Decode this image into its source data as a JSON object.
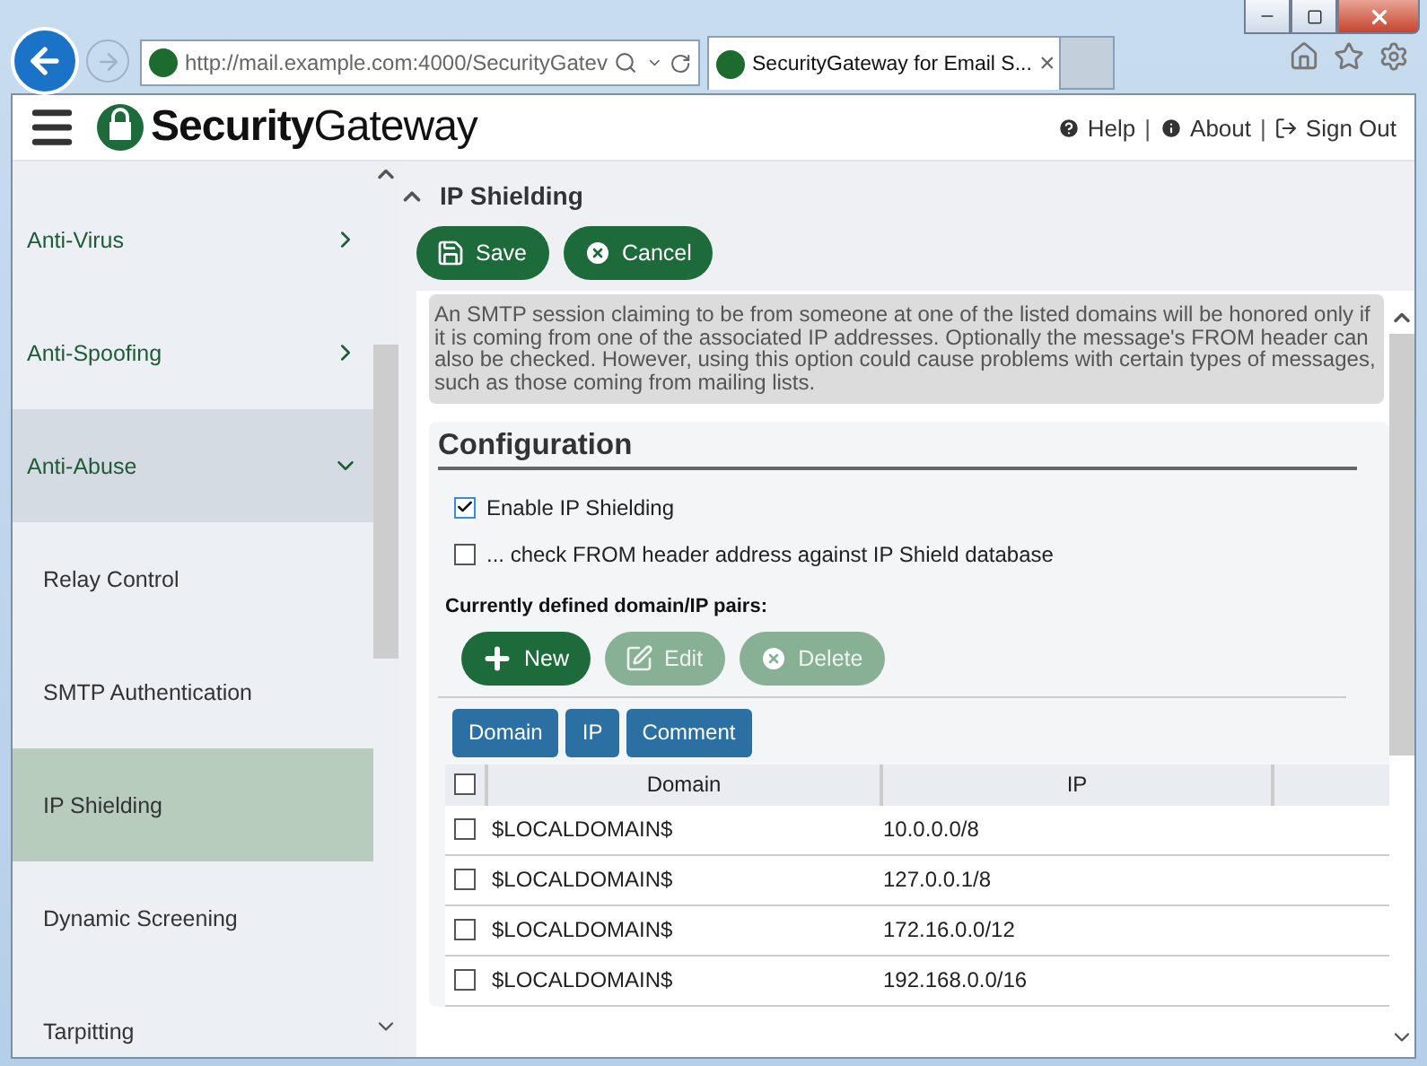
{
  "browser": {
    "address": "http://mail.example.com:4000/SecurityGatev",
    "tab_title": "SecurityGateway for Email S...",
    "tab_close": "×"
  },
  "header": {
    "logo": "**Security**Gateway",
    "links": [
      {
        "kind": "help",
        "label": "Help"
      },
      {
        "kind": "about",
        "label": "About"
      },
      {
        "kind": "signout",
        "label": "Sign Out"
      }
    ],
    "separator": "|"
  },
  "sidebar": {
    "items": [
      {
        "kind": "group",
        "label": "Anti-Virus",
        "expanded": false,
        "selected": false
      },
      {
        "kind": "group",
        "label": "Anti-Spoofing",
        "expanded": false,
        "selected": false
      },
      {
        "kind": "group",
        "label": "Anti-Abuse",
        "expanded": true,
        "selected": false
      },
      {
        "kind": "item",
        "label": "Relay Control",
        "selected": false
      },
      {
        "kind": "item",
        "label": "SMTP Authentication",
        "selected": false
      },
      {
        "kind": "item",
        "label": "IP Shielding",
        "selected": true
      },
      {
        "kind": "item",
        "label": "Dynamic Screening",
        "selected": false
      },
      {
        "kind": "item",
        "label": "Tarpitting",
        "selected": false
      }
    ]
  },
  "page": {
    "title": "IP Shielding",
    "actions": [
      {
        "kind": "save",
        "label": "Save"
      },
      {
        "kind": "cancel",
        "label": "Cancel"
      }
    ],
    "description": "An SMTP session claiming to be from someone at one of the listed domains will be honored only if it is coming from one of the associated IP addresses. Optionally the message's FROM header can also be checked. However, using this option could cause problems with certain types of messages, such as those coming from mailing lists."
  },
  "configuration": {
    "title": "Configuration",
    "options": [
      {
        "label": "Enable IP Shielding",
        "checked": true
      },
      {
        "label": "... check FROM header address against IP Shield database",
        "checked": false
      }
    ],
    "pairs_label": "Currently defined domain/IP pairs:",
    "toolbar": [
      {
        "kind": "new",
        "label": "New",
        "disabled": false
      },
      {
        "kind": "edit",
        "label": "Edit",
        "disabled": true
      },
      {
        "kind": "delete",
        "label": "Delete",
        "disabled": true
      }
    ],
    "column_toggles": [
      "Domain",
      "IP",
      "Comment"
    ]
  },
  "table": {
    "columns": [
      "Domain",
      "IP"
    ],
    "all_checked": false,
    "rows": [
      {
        "checked": false,
        "domain": "$LOCALDOMAIN$",
        "ip": "10.0.0.0/8"
      },
      {
        "checked": false,
        "domain": "$LOCALDOMAIN$",
        "ip": "127.0.0.1/8"
      },
      {
        "checked": false,
        "domain": "$LOCALDOMAIN$",
        "ip": "172.16.0.0/12"
      },
      {
        "checked": false,
        "domain": "$LOCALDOMAIN$",
        "ip": "192.168.0.0/16"
      }
    ]
  }
}
